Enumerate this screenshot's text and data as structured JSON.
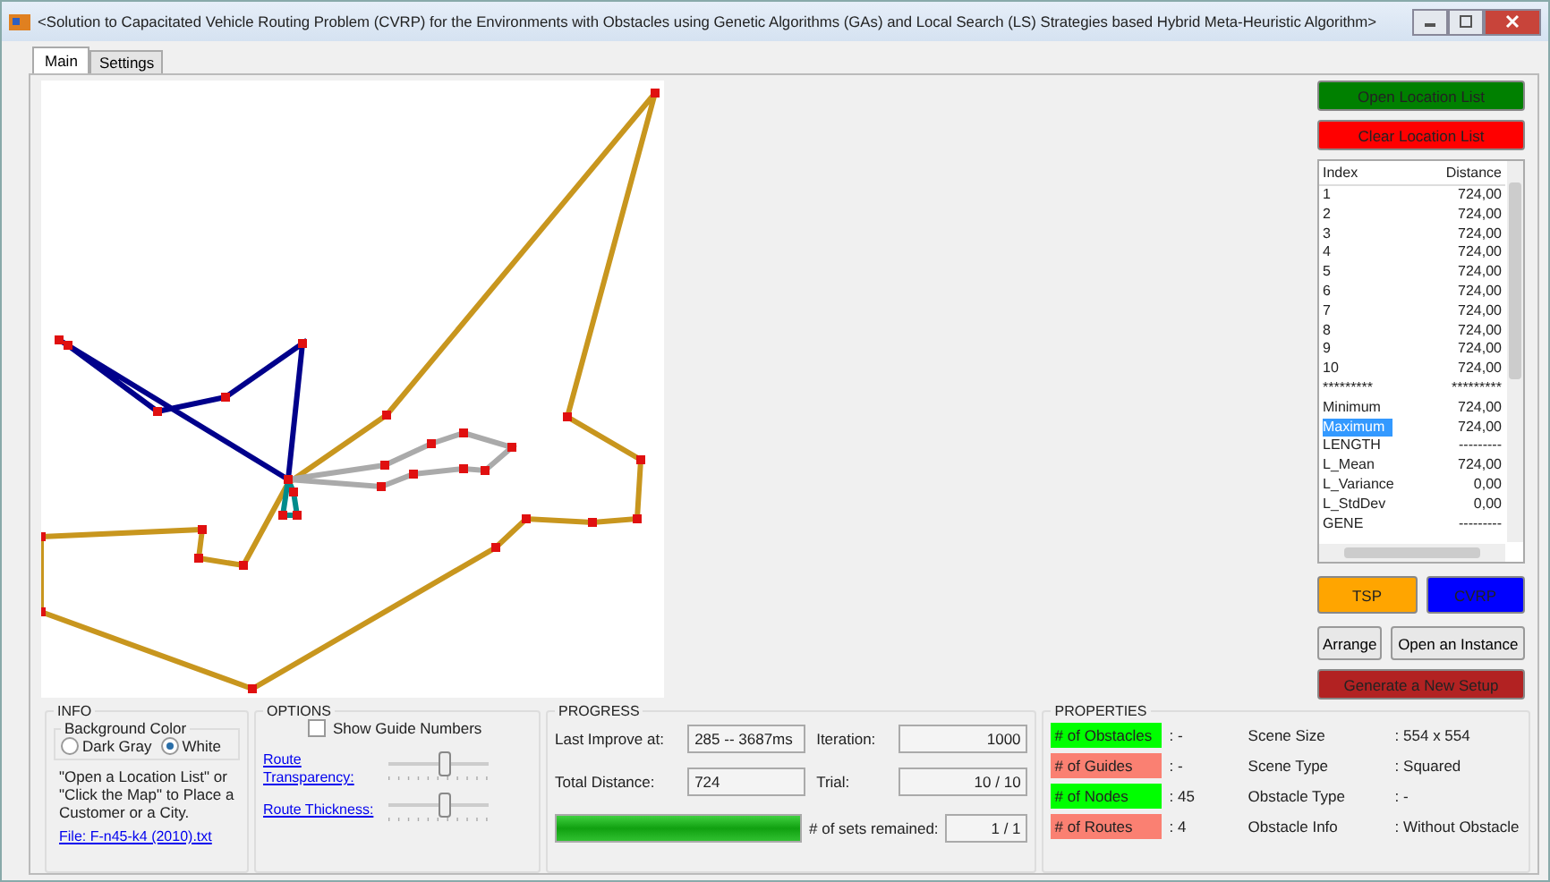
{
  "window": {
    "title": "<Solution to Capacitated Vehicle Routing Problem (CVRP) for the Environments with Obstacles using Genetic Algorithms (GAs) and Local Search (LS) Strategies based Hybrid Meta-Heuristic Algorithm>"
  },
  "tabs": [
    {
      "label": "Main",
      "selected": true
    },
    {
      "label": "Settings",
      "selected": false
    }
  ],
  "top_buttons": [
    {
      "label": "Open Location List",
      "color": "#008000"
    },
    {
      "label": "Clear Location List",
      "color": "#ff0000"
    }
  ],
  "results_list": {
    "columns": [
      "Index",
      "Distance"
    ],
    "rows": [
      {
        "index": "1",
        "distance": "724,00",
        "selected": false
      },
      {
        "index": "2",
        "distance": "724,00",
        "selected": false
      },
      {
        "index": "3",
        "distance": "724,00",
        "selected": false
      },
      {
        "index": "4",
        "distance": "724,00",
        "selected": false
      },
      {
        "index": "5",
        "distance": "724,00",
        "selected": false
      },
      {
        "index": "6",
        "distance": "724,00",
        "selected": false
      },
      {
        "index": "7",
        "distance": "724,00",
        "selected": false
      },
      {
        "index": "8",
        "distance": "724,00",
        "selected": false
      },
      {
        "index": "9",
        "distance": "724,00",
        "selected": false
      },
      {
        "index": "10",
        "distance": "724,00",
        "selected": false
      },
      {
        "index": "*********",
        "distance": "*********",
        "selected": false
      },
      {
        "index": "Minimum",
        "distance": "724,00",
        "selected": false
      },
      {
        "index": "Maximum",
        "distance": "724,00",
        "selected": true
      },
      {
        "index": "LENGTH",
        "distance": "---------",
        "selected": false
      },
      {
        "index": "L_Mean",
        "distance": "724,00",
        "selected": false
      },
      {
        "index": "L_Variance",
        "distance": "0,00",
        "selected": false
      },
      {
        "index": "L_StdDev",
        "distance": "0,00",
        "selected": false
      },
      {
        "index": "GENE",
        "distance": "---------",
        "selected": false
      }
    ]
  },
  "mode_buttons": [
    {
      "label": "TSP",
      "color": "#ffa500"
    },
    {
      "label": "CVRP",
      "color": "#0000ff"
    }
  ],
  "action_buttons": [
    "Arrange",
    "Open an Instance"
  ],
  "generate_button": {
    "label": "Generate a New Setup",
    "color": "#b22222"
  },
  "info": {
    "title": "INFO",
    "background_color": {
      "title": "Background Color",
      "options": [
        {
          "label": "Dark Gray",
          "selected": false
        },
        {
          "label": "White",
          "selected": true
        }
      ]
    },
    "hint": "\"Open a Location List\" or \"Click the Map\" to Place a Customer or a City.",
    "file_link": "File: F-n45-k4 (2010).txt"
  },
  "options": {
    "title": "OPTIONS",
    "show_guide_numbers": {
      "label": "Show Guide Numbers",
      "checked": false
    },
    "sliders": [
      {
        "label": "Route Transparency:",
        "level": 0.55
      },
      {
        "label": "Route Thickness:",
        "level": 0.55
      }
    ]
  },
  "progress": {
    "title": "PROGRESS",
    "last_improve_label": "Last Improve at:",
    "last_improve": "285 -- 3687ms",
    "total_distance_label": "Total Distance:",
    "total_distance": "724",
    "iteration_label": "Iteration:",
    "iteration": "1000",
    "trial_label": "Trial:",
    "trial": "10 / 10",
    "level": 1,
    "sets_label": "# of sets remained:",
    "sets": "1 / 1"
  },
  "properties": {
    "title": "PROPERTIES",
    "counts": [
      {
        "label": "# of Obstacles",
        "value": ": -",
        "color": "#00ff00"
      },
      {
        "label": "# of Guides",
        "value": ": -",
        "color": "#fa8072"
      },
      {
        "label": "# of Nodes",
        "value": ": 45",
        "color": "#00ff00"
      },
      {
        "label": "# of Routes",
        "value": ": 4",
        "color": "#fa8072"
      }
    ],
    "scene": [
      {
        "label": "Scene Size",
        "value": ": 554 x 554"
      },
      {
        "label": "Scene Type",
        "value": ": Squared"
      },
      {
        "label": "Obstacle Type",
        "value": ": -"
      },
      {
        "label": "Obstacle Info",
        "value": ": Without Obstacle"
      }
    ]
  }
}
